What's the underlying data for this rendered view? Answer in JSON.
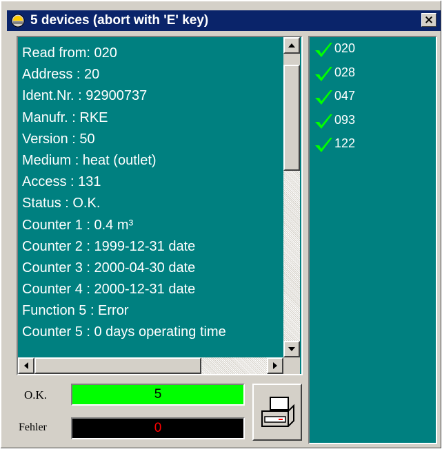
{
  "window": {
    "title": "5 devices (abort with 'E' key)",
    "close_glyph": "×",
    "icon": "meter-icon"
  },
  "readout": {
    "lines": [
      "Read from: 020",
      "Address :  20",
      "Ident.Nr. : 92900737",
      "Manufr. : RKE",
      "Version : 50",
      "Medium : heat (outlet)",
      "Access : 131",
      "Status : O.K.",
      "Counter 1 : 0.4 m³",
      "Counter 2 : 1999-12-31 date",
      "Counter 3 : 2000-04-30 date",
      "Counter 4 : 2000-12-31 date",
      "Function 5 : Error",
      "Counter 5 : 0 days operating time"
    ]
  },
  "devices": {
    "items": [
      "020",
      "028",
      "047",
      "093",
      "122"
    ],
    "status_icon": "check-icon",
    "check_color": "#00ff00"
  },
  "stats": {
    "ok_label": "O.K.",
    "ok_value": "5",
    "error_label": "Fehler",
    "error_value": "0",
    "ok_color": "#00ff00",
    "error_bg": "#000000",
    "error_text_color": "#ff0000"
  },
  "print": {
    "icon": "printer-icon"
  },
  "colors": {
    "titlebar": "#0a246a",
    "panel_bg": "#008080",
    "chrome": "#d4d0c8"
  }
}
